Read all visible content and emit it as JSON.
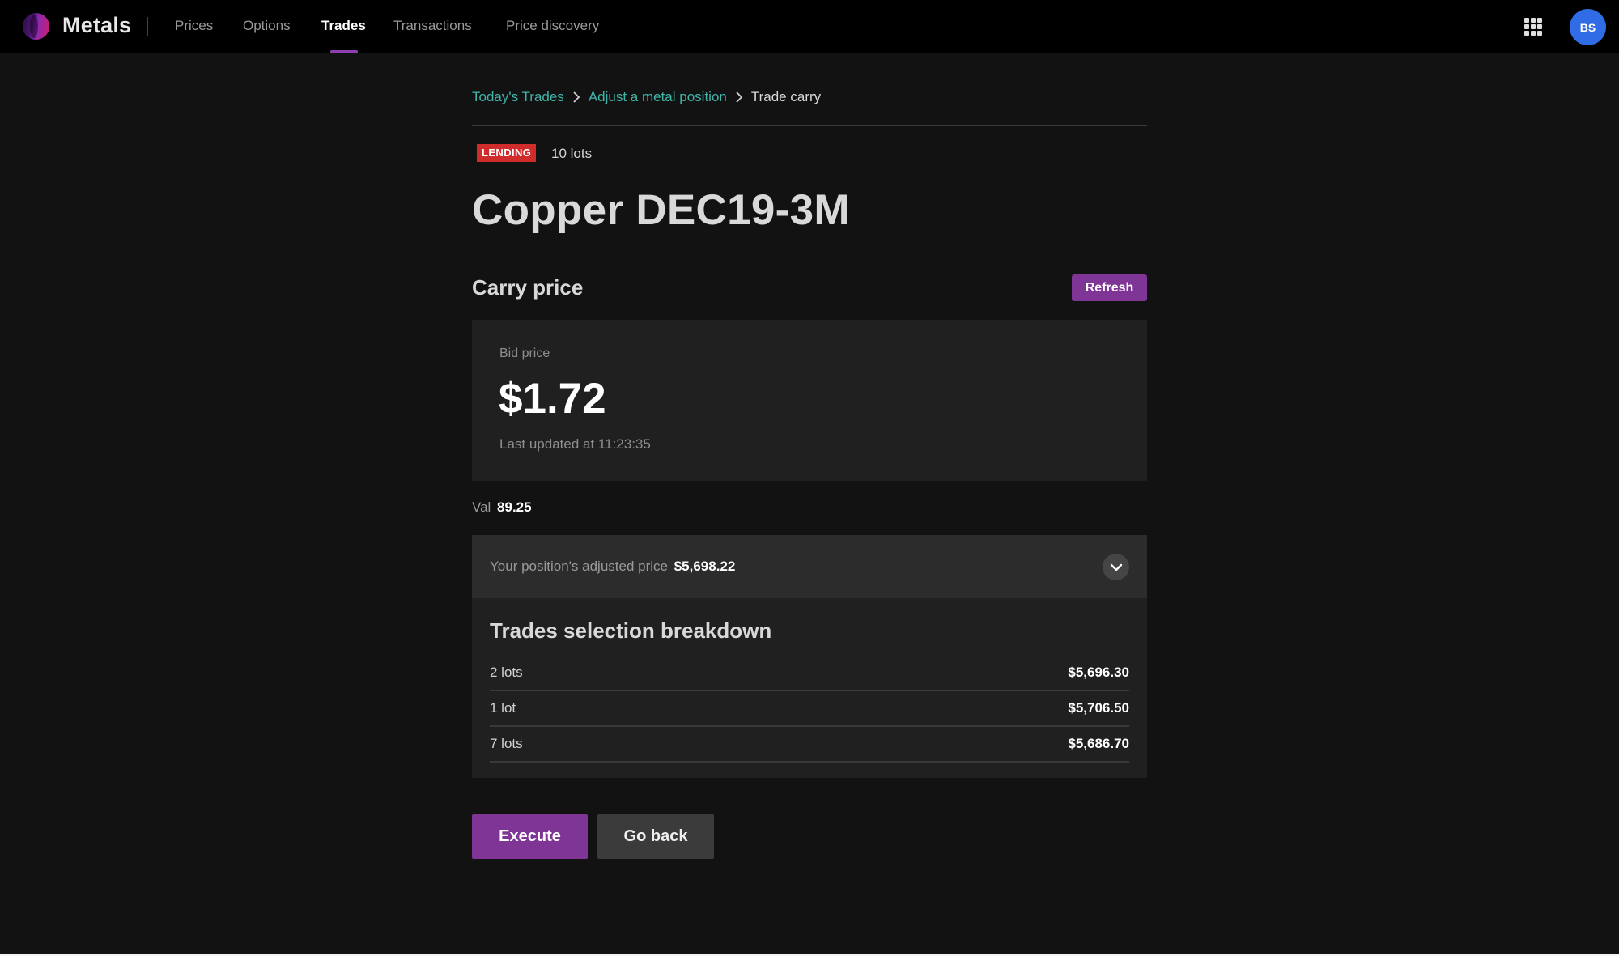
{
  "app": {
    "name": "Metals",
    "accent_color": "#7e3596",
    "link_color": "#3fb6a8"
  },
  "nav": {
    "items": [
      {
        "label": "Prices"
      },
      {
        "label": "Options"
      },
      {
        "label": "Trades",
        "active": true
      },
      {
        "label": "Transactions"
      },
      {
        "label": "Price discovery"
      }
    ],
    "apps_icon": "grid-icon",
    "user_initials": "BS"
  },
  "breadcrumb": {
    "items": [
      "Today's Trades",
      "Adjust a metal position",
      "Trade carry"
    ],
    "separator_icon": "chevron-right-icon"
  },
  "position": {
    "badge": "LENDING",
    "badge_color": "#d12c2c",
    "lots": "10 lots",
    "title": "Copper DEC19-3M"
  },
  "carry": {
    "section_title": "Carry price",
    "refresh_label": "Refresh",
    "bid_label": "Bid price",
    "bid_value": "$1.72",
    "last_updated": "Last updated at 11:23:35"
  },
  "val": {
    "label": "Val",
    "value": "89.25"
  },
  "adjusted": {
    "label": "Your position's adjusted price",
    "value": "$5,698.22",
    "toggle_icon": "chevron-down-icon"
  },
  "breakdown": {
    "title": "Trades selection breakdown",
    "rows": [
      {
        "lots": "2 lots",
        "price": "$5,696.30"
      },
      {
        "lots": "1 lot",
        "price": "$5,706.50"
      },
      {
        "lots": "7 lots",
        "price": "$5,686.70"
      }
    ]
  },
  "actions": {
    "execute_label": "Execute",
    "go_back_label": "Go back"
  }
}
